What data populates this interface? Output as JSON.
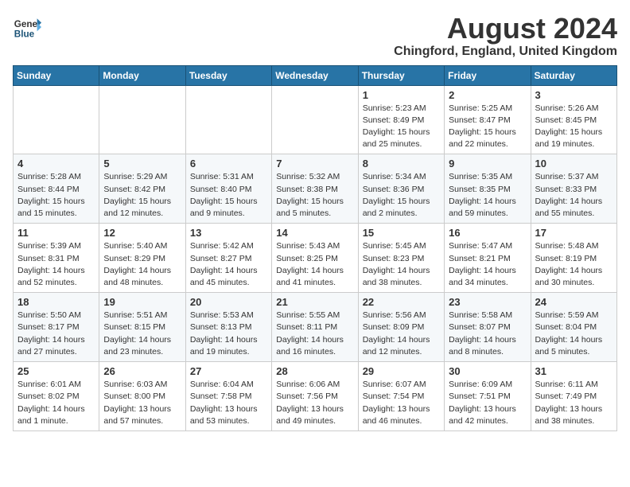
{
  "header": {
    "logo_line1": "General",
    "logo_line2": "Blue",
    "month_year": "August 2024",
    "location": "Chingford, England, United Kingdom"
  },
  "columns": [
    "Sunday",
    "Monday",
    "Tuesday",
    "Wednesday",
    "Thursday",
    "Friday",
    "Saturday"
  ],
  "weeks": [
    [
      {
        "day": "",
        "info": ""
      },
      {
        "day": "",
        "info": ""
      },
      {
        "day": "",
        "info": ""
      },
      {
        "day": "",
        "info": ""
      },
      {
        "day": "1",
        "info": "Sunrise: 5:23 AM\nSunset: 8:49 PM\nDaylight: 15 hours\nand 25 minutes."
      },
      {
        "day": "2",
        "info": "Sunrise: 5:25 AM\nSunset: 8:47 PM\nDaylight: 15 hours\nand 22 minutes."
      },
      {
        "day": "3",
        "info": "Sunrise: 5:26 AM\nSunset: 8:45 PM\nDaylight: 15 hours\nand 19 minutes."
      }
    ],
    [
      {
        "day": "4",
        "info": "Sunrise: 5:28 AM\nSunset: 8:44 PM\nDaylight: 15 hours\nand 15 minutes."
      },
      {
        "day": "5",
        "info": "Sunrise: 5:29 AM\nSunset: 8:42 PM\nDaylight: 15 hours\nand 12 minutes."
      },
      {
        "day": "6",
        "info": "Sunrise: 5:31 AM\nSunset: 8:40 PM\nDaylight: 15 hours\nand 9 minutes."
      },
      {
        "day": "7",
        "info": "Sunrise: 5:32 AM\nSunset: 8:38 PM\nDaylight: 15 hours\nand 5 minutes."
      },
      {
        "day": "8",
        "info": "Sunrise: 5:34 AM\nSunset: 8:36 PM\nDaylight: 15 hours\nand 2 minutes."
      },
      {
        "day": "9",
        "info": "Sunrise: 5:35 AM\nSunset: 8:35 PM\nDaylight: 14 hours\nand 59 minutes."
      },
      {
        "day": "10",
        "info": "Sunrise: 5:37 AM\nSunset: 8:33 PM\nDaylight: 14 hours\nand 55 minutes."
      }
    ],
    [
      {
        "day": "11",
        "info": "Sunrise: 5:39 AM\nSunset: 8:31 PM\nDaylight: 14 hours\nand 52 minutes."
      },
      {
        "day": "12",
        "info": "Sunrise: 5:40 AM\nSunset: 8:29 PM\nDaylight: 14 hours\nand 48 minutes."
      },
      {
        "day": "13",
        "info": "Sunrise: 5:42 AM\nSunset: 8:27 PM\nDaylight: 14 hours\nand 45 minutes."
      },
      {
        "day": "14",
        "info": "Sunrise: 5:43 AM\nSunset: 8:25 PM\nDaylight: 14 hours\nand 41 minutes."
      },
      {
        "day": "15",
        "info": "Sunrise: 5:45 AM\nSunset: 8:23 PM\nDaylight: 14 hours\nand 38 minutes."
      },
      {
        "day": "16",
        "info": "Sunrise: 5:47 AM\nSunset: 8:21 PM\nDaylight: 14 hours\nand 34 minutes."
      },
      {
        "day": "17",
        "info": "Sunrise: 5:48 AM\nSunset: 8:19 PM\nDaylight: 14 hours\nand 30 minutes."
      }
    ],
    [
      {
        "day": "18",
        "info": "Sunrise: 5:50 AM\nSunset: 8:17 PM\nDaylight: 14 hours\nand 27 minutes."
      },
      {
        "day": "19",
        "info": "Sunrise: 5:51 AM\nSunset: 8:15 PM\nDaylight: 14 hours\nand 23 minutes."
      },
      {
        "day": "20",
        "info": "Sunrise: 5:53 AM\nSunset: 8:13 PM\nDaylight: 14 hours\nand 19 minutes."
      },
      {
        "day": "21",
        "info": "Sunrise: 5:55 AM\nSunset: 8:11 PM\nDaylight: 14 hours\nand 16 minutes."
      },
      {
        "day": "22",
        "info": "Sunrise: 5:56 AM\nSunset: 8:09 PM\nDaylight: 14 hours\nand 12 minutes."
      },
      {
        "day": "23",
        "info": "Sunrise: 5:58 AM\nSunset: 8:07 PM\nDaylight: 14 hours\nand 8 minutes."
      },
      {
        "day": "24",
        "info": "Sunrise: 5:59 AM\nSunset: 8:04 PM\nDaylight: 14 hours\nand 5 minutes."
      }
    ],
    [
      {
        "day": "25",
        "info": "Sunrise: 6:01 AM\nSunset: 8:02 PM\nDaylight: 14 hours\nand 1 minute."
      },
      {
        "day": "26",
        "info": "Sunrise: 6:03 AM\nSunset: 8:00 PM\nDaylight: 13 hours\nand 57 minutes."
      },
      {
        "day": "27",
        "info": "Sunrise: 6:04 AM\nSunset: 7:58 PM\nDaylight: 13 hours\nand 53 minutes."
      },
      {
        "day": "28",
        "info": "Sunrise: 6:06 AM\nSunset: 7:56 PM\nDaylight: 13 hours\nand 49 minutes."
      },
      {
        "day": "29",
        "info": "Sunrise: 6:07 AM\nSunset: 7:54 PM\nDaylight: 13 hours\nand 46 minutes."
      },
      {
        "day": "30",
        "info": "Sunrise: 6:09 AM\nSunset: 7:51 PM\nDaylight: 13 hours\nand 42 minutes."
      },
      {
        "day": "31",
        "info": "Sunrise: 6:11 AM\nSunset: 7:49 PM\nDaylight: 13 hours\nand 38 minutes."
      }
    ]
  ]
}
